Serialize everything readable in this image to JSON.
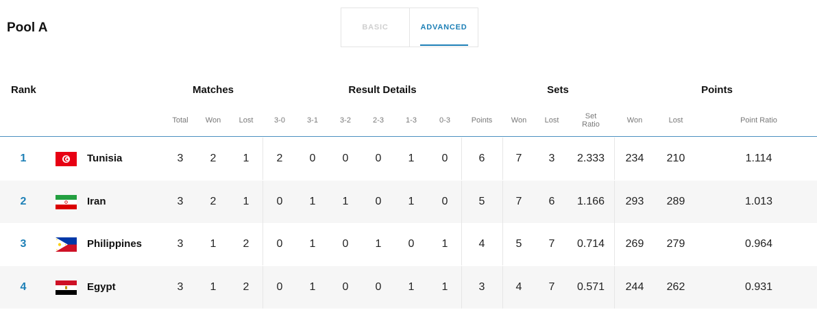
{
  "title": "Pool A",
  "tabs": {
    "basic": "BASIC",
    "advanced": "ADVANCED",
    "active": "ADVANCED"
  },
  "groups": {
    "rank": "Rank",
    "matches": "Matches",
    "result_details": "Result Details",
    "sets": "Sets",
    "points": "Points"
  },
  "subheaders": {
    "total": "Total",
    "won": "Won",
    "lost": "Lost",
    "r30": "3-0",
    "r31": "3-1",
    "r32": "3-2",
    "r23": "2-3",
    "r13": "1-3",
    "r03": "0-3",
    "points": "Points",
    "sets_won": "Won",
    "sets_lost": "Lost",
    "set_ratio_1": "Set",
    "set_ratio_2": "Ratio",
    "pts_won": "Won",
    "pts_lost": "Lost",
    "point_ratio": "Point Ratio"
  },
  "rows": [
    {
      "rank": "1",
      "team": "Tunisia",
      "flag": "tunisia-flag-icon",
      "total": "3",
      "won": "2",
      "lost": "1",
      "r30": "2",
      "r31": "0",
      "r32": "0",
      "r23": "0",
      "r13": "1",
      "r03": "0",
      "points": "6",
      "sets_won": "7",
      "sets_lost": "3",
      "set_ratio": "2.333",
      "pts_won": "234",
      "pts_lost": "210",
      "point_ratio": "1.114"
    },
    {
      "rank": "2",
      "team": "Iran",
      "flag": "iran-flag-icon",
      "total": "3",
      "won": "2",
      "lost": "1",
      "r30": "0",
      "r31": "1",
      "r32": "1",
      "r23": "0",
      "r13": "1",
      "r03": "0",
      "points": "5",
      "sets_won": "7",
      "sets_lost": "6",
      "set_ratio": "1.166",
      "pts_won": "293",
      "pts_lost": "289",
      "point_ratio": "1.013"
    },
    {
      "rank": "3",
      "team": "Philippines",
      "flag": "philippines-flag-icon",
      "total": "3",
      "won": "1",
      "lost": "2",
      "r30": "0",
      "r31": "1",
      "r32": "0",
      "r23": "1",
      "r13": "0",
      "r03": "1",
      "points": "4",
      "sets_won": "5",
      "sets_lost": "7",
      "set_ratio": "0.714",
      "pts_won": "269",
      "pts_lost": "279",
      "point_ratio": "0.964"
    },
    {
      "rank": "4",
      "team": "Egypt",
      "flag": "egypt-flag-icon",
      "total": "3",
      "won": "1",
      "lost": "2",
      "r30": "0",
      "r31": "1",
      "r32": "0",
      "r23": "0",
      "r13": "1",
      "r03": "1",
      "points": "3",
      "sets_won": "4",
      "sets_lost": "7",
      "set_ratio": "0.571",
      "pts_won": "244",
      "pts_lost": "262",
      "point_ratio": "0.931"
    }
  ],
  "colors": {
    "accent": "#1c7fb6",
    "row_alt": "#f6f6f6",
    "header_line": "#4a8fc0"
  }
}
